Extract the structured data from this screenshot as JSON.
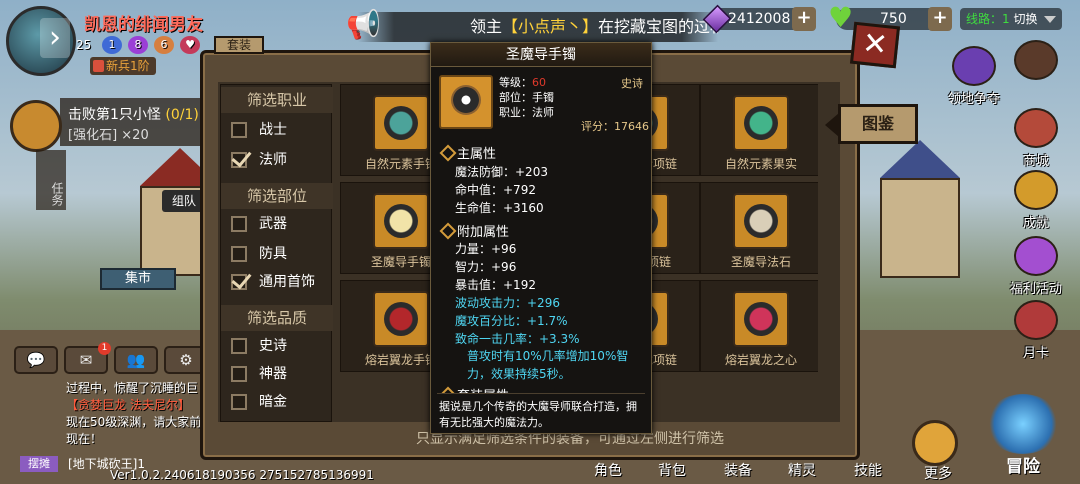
{
  "player": {
    "name": "凯恩的绯闻男友",
    "level": "25",
    "medals": [
      "1",
      "8",
      "6"
    ],
    "rank_tag": "新兵1阶"
  },
  "broadcast": {
    "prefix": "领主",
    "highlight": "【小点声丶】",
    "text": "在挖藏宝图的过程"
  },
  "resources": {
    "gems": "2412008",
    "stamina": "750",
    "plus": "+"
  },
  "server_line": {
    "line": "线路：1",
    "switch": "切换"
  },
  "quest": {
    "title": "击败第1只小怪",
    "progress": "(0/1)",
    "reward": "[强化石] ×20",
    "task_label": "任务",
    "team_label": "组队",
    "market_label": "集市"
  },
  "chat": {
    "line1": "过程中，惊醒了沉睡的巨",
    "line2": "【贪婪巨龙 法夫尼尔】",
    "line3": "现在50级深渊，请大家前",
    "line4": "现在！",
    "stall": "摆摊",
    "map": "[地下城砍王]1",
    "notif": "1"
  },
  "version": "Ver1.0.2.240618190356 275152785136991",
  "right_menu": [
    {
      "label": "领地争夺"
    },
    {
      "label": "商城"
    },
    {
      "label": "成就"
    },
    {
      "label": "福利活动"
    },
    {
      "label": "月卡"
    }
  ],
  "bottom_tabs": [
    "角色",
    "背包",
    "装备",
    "精灵",
    "技能"
  ],
  "more_label": "更多",
  "adventure_label": "冒险",
  "dialog": {
    "close": "✕",
    "tujian": "图鉴",
    "tab_stub": "套装",
    "hint": "只显示满足筛选条件的装备，可通过左侧进行筛选",
    "filters": {
      "class_head": "筛选职业",
      "class_items": [
        {
          "label": "战士",
          "checked": false
        },
        {
          "label": "法师",
          "checked": true
        }
      ],
      "part_head": "筛选部位",
      "part_items": [
        {
          "label": "武器",
          "checked": false
        },
        {
          "label": "防具",
          "checked": false
        },
        {
          "label": "通用首饰",
          "checked": true
        }
      ],
      "quality_head": "筛选品质",
      "quality_items": [
        {
          "label": "史诗",
          "checked": false
        },
        {
          "label": "神器",
          "checked": false
        },
        {
          "label": "暗金",
          "checked": false
        }
      ]
    },
    "items": [
      {
        "name": "自然元素手镯",
        "color": "#4ca39a"
      },
      {
        "name": "",
        "color": "#4ca39a"
      },
      {
        "name": "自然元素项链",
        "color": "#4ca39a"
      },
      {
        "name": "自然元素果实",
        "color": "#43b48a"
      },
      {
        "name": "圣魔导手镯",
        "color": "#f1e3a8"
      },
      {
        "name": "",
        "color": "#555"
      },
      {
        "name": "圣魔导项链",
        "color": "#555"
      },
      {
        "name": "圣魔导法石",
        "color": "#d9cfb8"
      },
      {
        "name": "熔岩翼龙手镯",
        "color": "#b3272b"
      },
      {
        "name": "",
        "color": "#333"
      },
      {
        "name": "熔岩翼龙项链",
        "color": "#333"
      },
      {
        "name": "熔岩翼龙之心",
        "color": "#d0345a"
      }
    ]
  },
  "tooltip": {
    "title": "圣魔导手镯",
    "quality": "史诗",
    "level_label": "等级：",
    "level": "60",
    "part": "部位：手镯",
    "class": "职业：法师",
    "score": "评分：17646",
    "main_head": "主属性",
    "main_stats": [
      "魔法防御：+203",
      "命中值：+792",
      "生命值：+3160"
    ],
    "extra_head": "附加属性",
    "extra_stats": [
      "力量：+96",
      "智力：+96",
      "暴击值：+192"
    ],
    "special_stats": [
      "波动攻击力：+296",
      "魔攻百分比：+1.7%",
      "致命一击几率：+3.3%"
    ],
    "effect": "普攻时有10%几率增加10%智力，效果持续5秒。",
    "set_head": "套装属性",
    "description": "据说是几个传奇的大魔导师联合打造，拥有无比强大的魔法力。"
  }
}
